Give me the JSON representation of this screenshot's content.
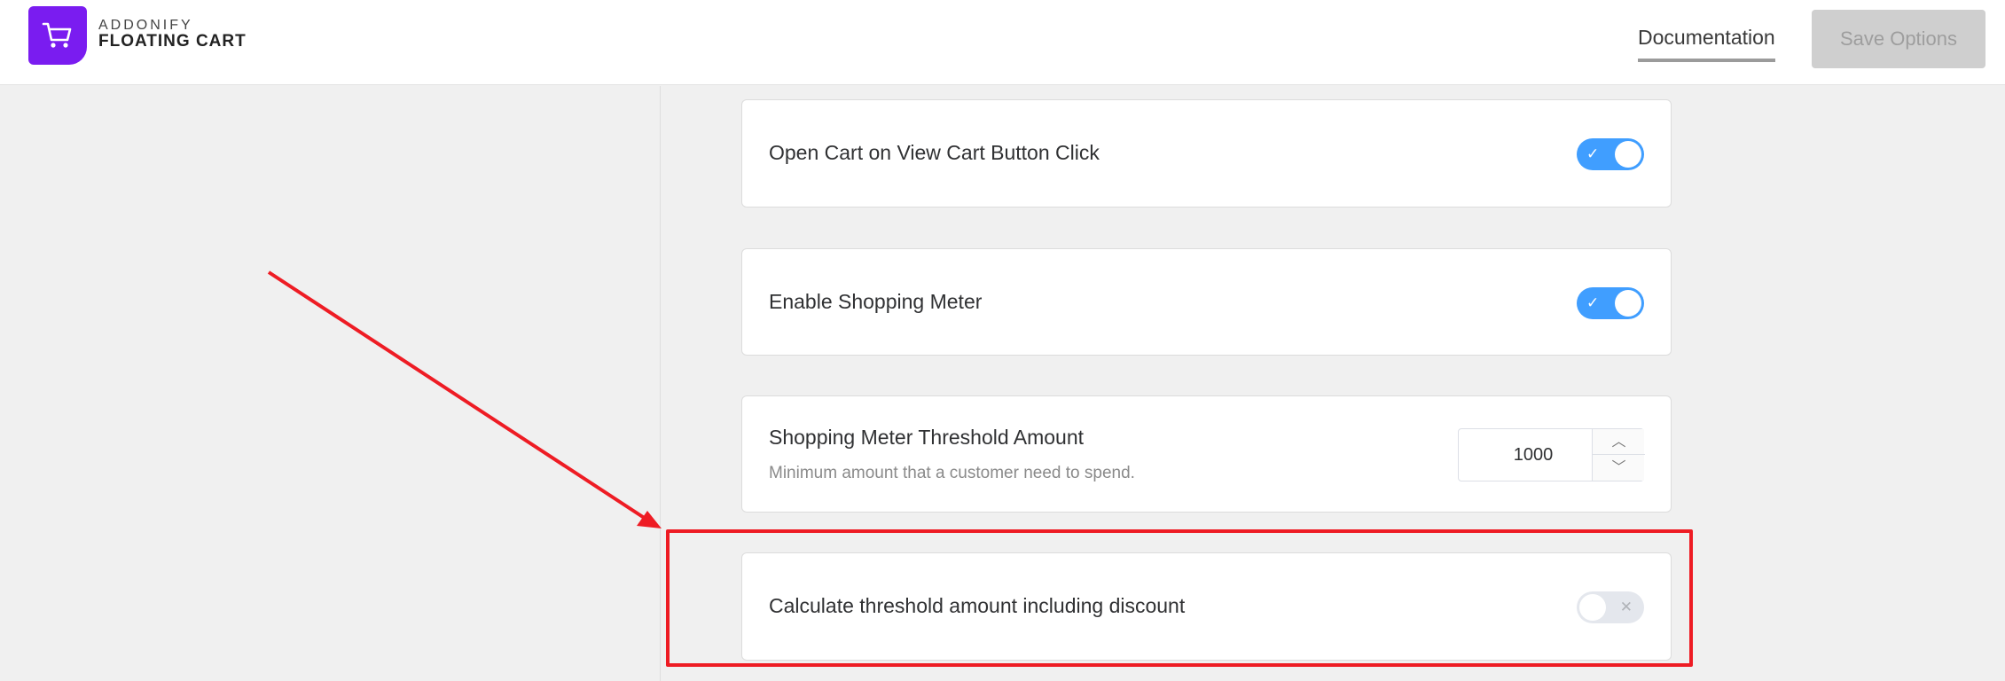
{
  "header": {
    "brand_top": "ADDONIFY",
    "brand_bottom": "FLOATING CART",
    "logo_icon": "shopping-cart-icon",
    "documentation_label": "Documentation",
    "save_label": "Save Options"
  },
  "settings": [
    {
      "label": "Open Cart on View Cart Button Click",
      "enabled": true
    },
    {
      "label": "Enable Shopping Meter",
      "enabled": true
    },
    {
      "label": "Shopping Meter Threshold Amount",
      "description": "Minimum amount that a customer need to spend.",
      "value": "1000"
    },
    {
      "label": "Calculate threshold amount including discount",
      "enabled": false
    }
  ],
  "icons": {
    "check": "check-icon",
    "cross": "close-icon",
    "up": "chevron-up-icon",
    "down": "chevron-down-icon"
  },
  "colors": {
    "brand": "#7a1cf0",
    "toggle_on": "#409eff",
    "toggle_off": "#e4e7ed",
    "annotation": "#ee1c24"
  }
}
